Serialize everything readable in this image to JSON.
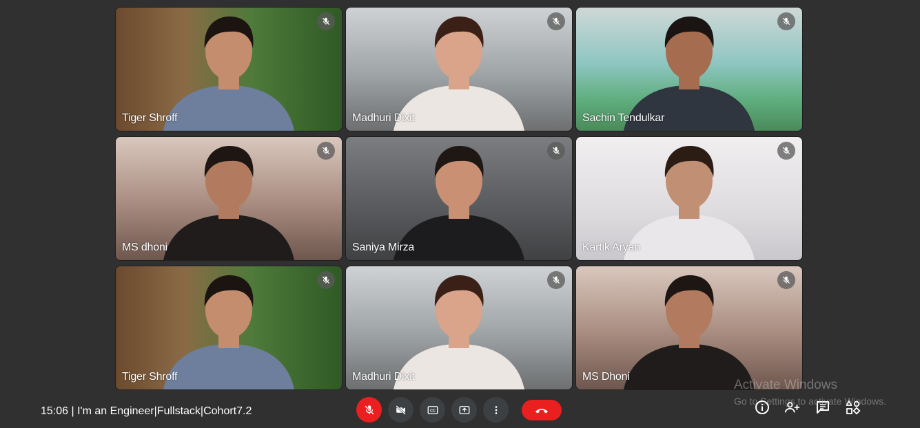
{
  "participants": [
    {
      "name": "Tiger Shroff",
      "bg": "garden",
      "skin": "#c48d6e",
      "hair": "#1c1410",
      "shirt": "#6d7f9c"
    },
    {
      "name": "Madhuri Dixit",
      "bg": "grey",
      "skin": "#d9a489",
      "hair": "#3a2016",
      "shirt": "#ece6e3"
    },
    {
      "name": "Sachin Tendulkar",
      "bg": "stadium",
      "skin": "#a56c4f",
      "hair": "#1a1412",
      "shirt": "#2f3640"
    },
    {
      "name": "MS dhoni",
      "bg": "dhoni",
      "skin": "#b27a5e",
      "hair": "#1d1613",
      "shirt": "#1f1c1b"
    },
    {
      "name": "Saniya Mirza",
      "bg": "studio",
      "skin": "#c99074",
      "hair": "#1e1714",
      "shirt": "#1c1c1e"
    },
    {
      "name": "Kartik Aryan",
      "bg": "white",
      "skin": "#c18f73",
      "hair": "#2b1c14",
      "shirt": "#e9e7ea"
    },
    {
      "name": "Tiger Shroff",
      "bg": "garden",
      "skin": "#c48d6e",
      "hair": "#1c1410",
      "shirt": "#6d7f9c"
    },
    {
      "name": "Madhuri Dixit",
      "bg": "grey",
      "skin": "#d9a489",
      "hair": "#3a2016",
      "shirt": "#ece6e3"
    },
    {
      "name": "MS Dhoni",
      "bg": "dhoni",
      "skin": "#b27a5e",
      "hair": "#1d1613",
      "shirt": "#1f1c1b"
    }
  ],
  "footer": {
    "meeting_info": "15:06 | I'm an Engineer|Fullstack|Cohort7.2"
  },
  "controls": [
    {
      "name": "mic-off-button",
      "icon": "mic-off-icon",
      "active_color": "#ea1f1f"
    },
    {
      "name": "camera-off-button",
      "icon": "video-off-icon"
    },
    {
      "name": "captions-button",
      "icon": "closed-caption-icon"
    },
    {
      "name": "present-screen-button",
      "icon": "present-to-all-icon"
    },
    {
      "name": "more-options-button",
      "icon": "more-vert-icon"
    },
    {
      "name": "leave-call-button",
      "icon": "call-end-icon",
      "active_color": "#ea1f1f"
    }
  ],
  "side_controls": [
    {
      "name": "meeting-details-button",
      "icon": "info-icon"
    },
    {
      "name": "people-button",
      "icon": "person-add-icon"
    },
    {
      "name": "chat-button",
      "icon": "chat-icon"
    },
    {
      "name": "activities-button",
      "icon": "shapes-icon"
    }
  ],
  "watermark": {
    "line1": "Activate Windows",
    "line2": "Go to Settings to activate Windows."
  }
}
